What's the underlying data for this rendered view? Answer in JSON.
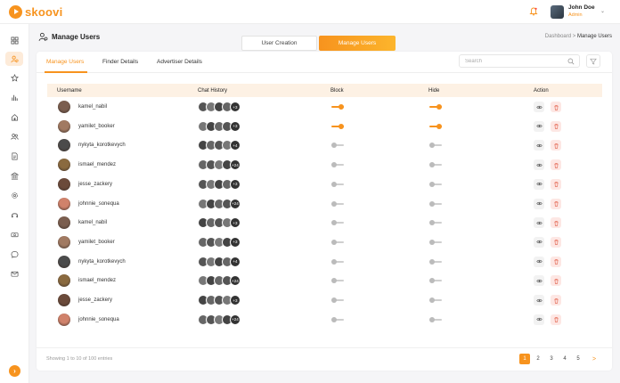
{
  "brand": {
    "name": "skoovi",
    "color": "#f7931e"
  },
  "header": {
    "user_name": "John Doe",
    "user_role": "Admin",
    "notification_icon": "bell-icon"
  },
  "sidebar": {
    "items": [
      {
        "icon": "dashboard-icon"
      },
      {
        "icon": "manage-users-icon",
        "active": true
      },
      {
        "icon": "star-icon"
      },
      {
        "icon": "bar-chart-icon"
      },
      {
        "icon": "home-icon"
      },
      {
        "icon": "users-icon"
      },
      {
        "icon": "document-icon"
      },
      {
        "icon": "bank-icon"
      },
      {
        "icon": "settings-icon"
      },
      {
        "icon": "headset-icon"
      },
      {
        "icon": "money-icon"
      },
      {
        "icon": "chat-icon"
      },
      {
        "icon": "mail-icon"
      }
    ]
  },
  "page": {
    "title": "Manage Users",
    "segments": [
      "User Creation",
      "Manage Users"
    ],
    "breadcrumb_root": "Dashboard",
    "breadcrumb_sep": ">",
    "breadcrumb_current": "Manage Users"
  },
  "tabs": [
    "Manage Users",
    "Finder Details",
    "Advertiser Details"
  ],
  "search": {
    "placeholder": "Search"
  },
  "table": {
    "columns": [
      "Username",
      "Chat History",
      "Block",
      "Hide",
      "Action"
    ],
    "rows": [
      {
        "username": "kamel_nabil",
        "chat_count": "+3",
        "block": true,
        "hide": true
      },
      {
        "username": "yamilet_booker",
        "chat_count": "+3",
        "block": true,
        "hide": true
      },
      {
        "username": "nykyta_korotkevych",
        "chat_count": "+4",
        "block": false,
        "hide": false
      },
      {
        "username": "ismael_mendez",
        "chat_count": "+24",
        "block": false,
        "hide": false
      },
      {
        "username": "jesse_zackery",
        "chat_count": "+3",
        "block": false,
        "hide": false
      },
      {
        "username": "johnnie_sonequa",
        "chat_count": "+24",
        "block": false,
        "hide": false
      },
      {
        "username": "kamel_nabil",
        "chat_count": "+3",
        "block": false,
        "hide": false
      },
      {
        "username": "yamilet_booker",
        "chat_count": "+3",
        "block": false,
        "hide": false
      },
      {
        "username": "nykyta_korotkevych",
        "chat_count": "+4",
        "block": false,
        "hide": false
      },
      {
        "username": "ismael_mendez",
        "chat_count": "+24",
        "block": false,
        "hide": false
      },
      {
        "username": "jesse_zackery",
        "chat_count": "+3",
        "block": false,
        "hide": false
      },
      {
        "username": "johnnie_sonequa",
        "chat_count": "+24",
        "block": false,
        "hide": false
      }
    ]
  },
  "footer": {
    "entries_text": "Showing 1 to 10 of 100 entries",
    "pages": [
      "1",
      "2",
      "3",
      "4",
      "5"
    ],
    "current_page": "1",
    "next_label": ">"
  }
}
